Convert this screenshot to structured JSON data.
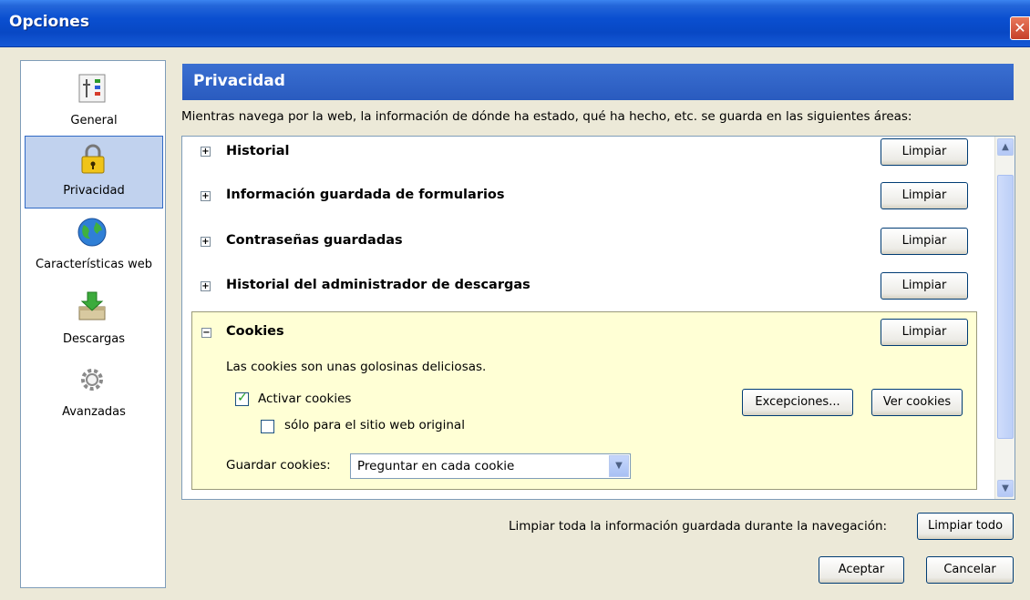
{
  "window": {
    "title": "Opciones",
    "close_glyph": "✕"
  },
  "sidebar": {
    "items": [
      {
        "label": "General",
        "icon": "general-icon"
      },
      {
        "label": "Privacidad",
        "icon": "lock-icon",
        "selected": true
      },
      {
        "label": "Características web",
        "icon": "globe-icon"
      },
      {
        "label": "Descargas",
        "icon": "downloads-icon"
      },
      {
        "label": "Avanzadas",
        "icon": "gears-icon"
      }
    ]
  },
  "pane": {
    "title": "Privacidad",
    "description": "Mientras navega por la web, la información de dónde ha estado, qué ha hecho, etc. se guarda en las siguientes áreas:"
  },
  "sections": [
    {
      "title": "Historial",
      "expander": "+",
      "button": "Limpiar"
    },
    {
      "title": "Información guardada de formularios",
      "expander": "+",
      "button": "Limpiar"
    },
    {
      "title": "Contraseñas guardadas",
      "expander": "+",
      "button": "Limpiar"
    },
    {
      "title": "Historial del administrador de descargas",
      "expander": "+",
      "button": "Limpiar"
    }
  ],
  "cookies": {
    "title": "Cookies",
    "expander": "−",
    "button": "Limpiar",
    "description": "Las cookies son unas golosinas deliciosas.",
    "enable_label": "Activar cookies",
    "enable_checked": true,
    "original_site_label": "sólo para el sitio web original",
    "original_site_checked": false,
    "exceptions_button": "Excepciones...",
    "view_button": "Ver cookies",
    "keep_label": "Guardar cookies:",
    "keep_value": "Preguntar en cada cookie"
  },
  "footer": {
    "clear_label": "Limpiar toda la información guardada durante la navegación:",
    "clear_all_button": "Limpiar todo",
    "ok_button": "Aceptar",
    "cancel_button": "Cancelar"
  },
  "colors": {
    "accent": "#2a5bbf",
    "cookies_bg": "#ffffd5",
    "selected": "#c1d2ee"
  }
}
